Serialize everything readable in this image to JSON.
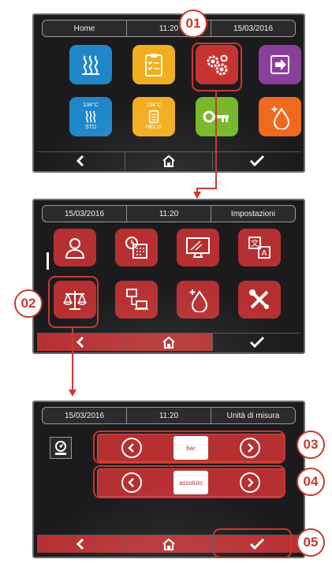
{
  "screen1": {
    "status": {
      "title": "Home",
      "time": "11:20",
      "date": "15/03/2016"
    },
    "tiles": [
      {
        "name": "sterilization-icon",
        "color": "#1f87c9",
        "label": ""
      },
      {
        "name": "checklist-icon",
        "color": "#f2ae1e",
        "label": ""
      },
      {
        "name": "settings-gears-icon",
        "color": "#c63431",
        "label": ""
      },
      {
        "name": "exit-icon",
        "color": "#8a3f9c",
        "label": ""
      },
      {
        "name": "std-cycle-icon",
        "color": "#1f87c9",
        "temp": "134°C",
        "label": "STD"
      },
      {
        "name": "helix-cycle-icon",
        "color": "#f2ae1e",
        "temp": "134°C",
        "label": "HELIX"
      },
      {
        "name": "key-icon",
        "color": "#76b82a",
        "label": ""
      },
      {
        "name": "water-drop-plus-icon",
        "color": "#ee6a1f",
        "label": ""
      }
    ]
  },
  "screen2": {
    "status": {
      "date": "15/03/2016",
      "time": "11:20",
      "title": "Impostazioni"
    }
  },
  "screen3": {
    "status": {
      "date": "15/03/2016",
      "time": "11:20",
      "title": "Unità di misura"
    },
    "pressure_unit": "bar",
    "pressure_type": "assoluto"
  },
  "callouts": {
    "c01": "01",
    "c02": "02",
    "c03": "03",
    "c04": "04",
    "c05": "05"
  }
}
